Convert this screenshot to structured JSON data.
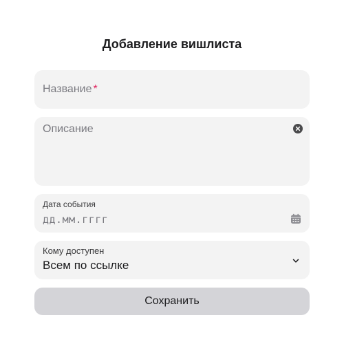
{
  "form": {
    "title": "Добавление вишлиста",
    "name_field": {
      "placeholder": "Название",
      "required_mark": "*"
    },
    "description_field": {
      "placeholder": "Описание",
      "clear_icon": "close-circle-icon"
    },
    "date_field": {
      "label": "Дата события",
      "placeholder": "дд.мм.гггг",
      "icon": "calendar-icon"
    },
    "access_field": {
      "label": "Кому доступен",
      "value": "Всем по ссылке",
      "icon": "chevron-down-icon"
    },
    "save_button": {
      "label": "Сохранить"
    }
  },
  "colors": {
    "field_background": "#f3f3f3",
    "button_background": "#d4d4d8",
    "required_mark": "#e0245e",
    "placeholder_text": "#7a7a80"
  }
}
